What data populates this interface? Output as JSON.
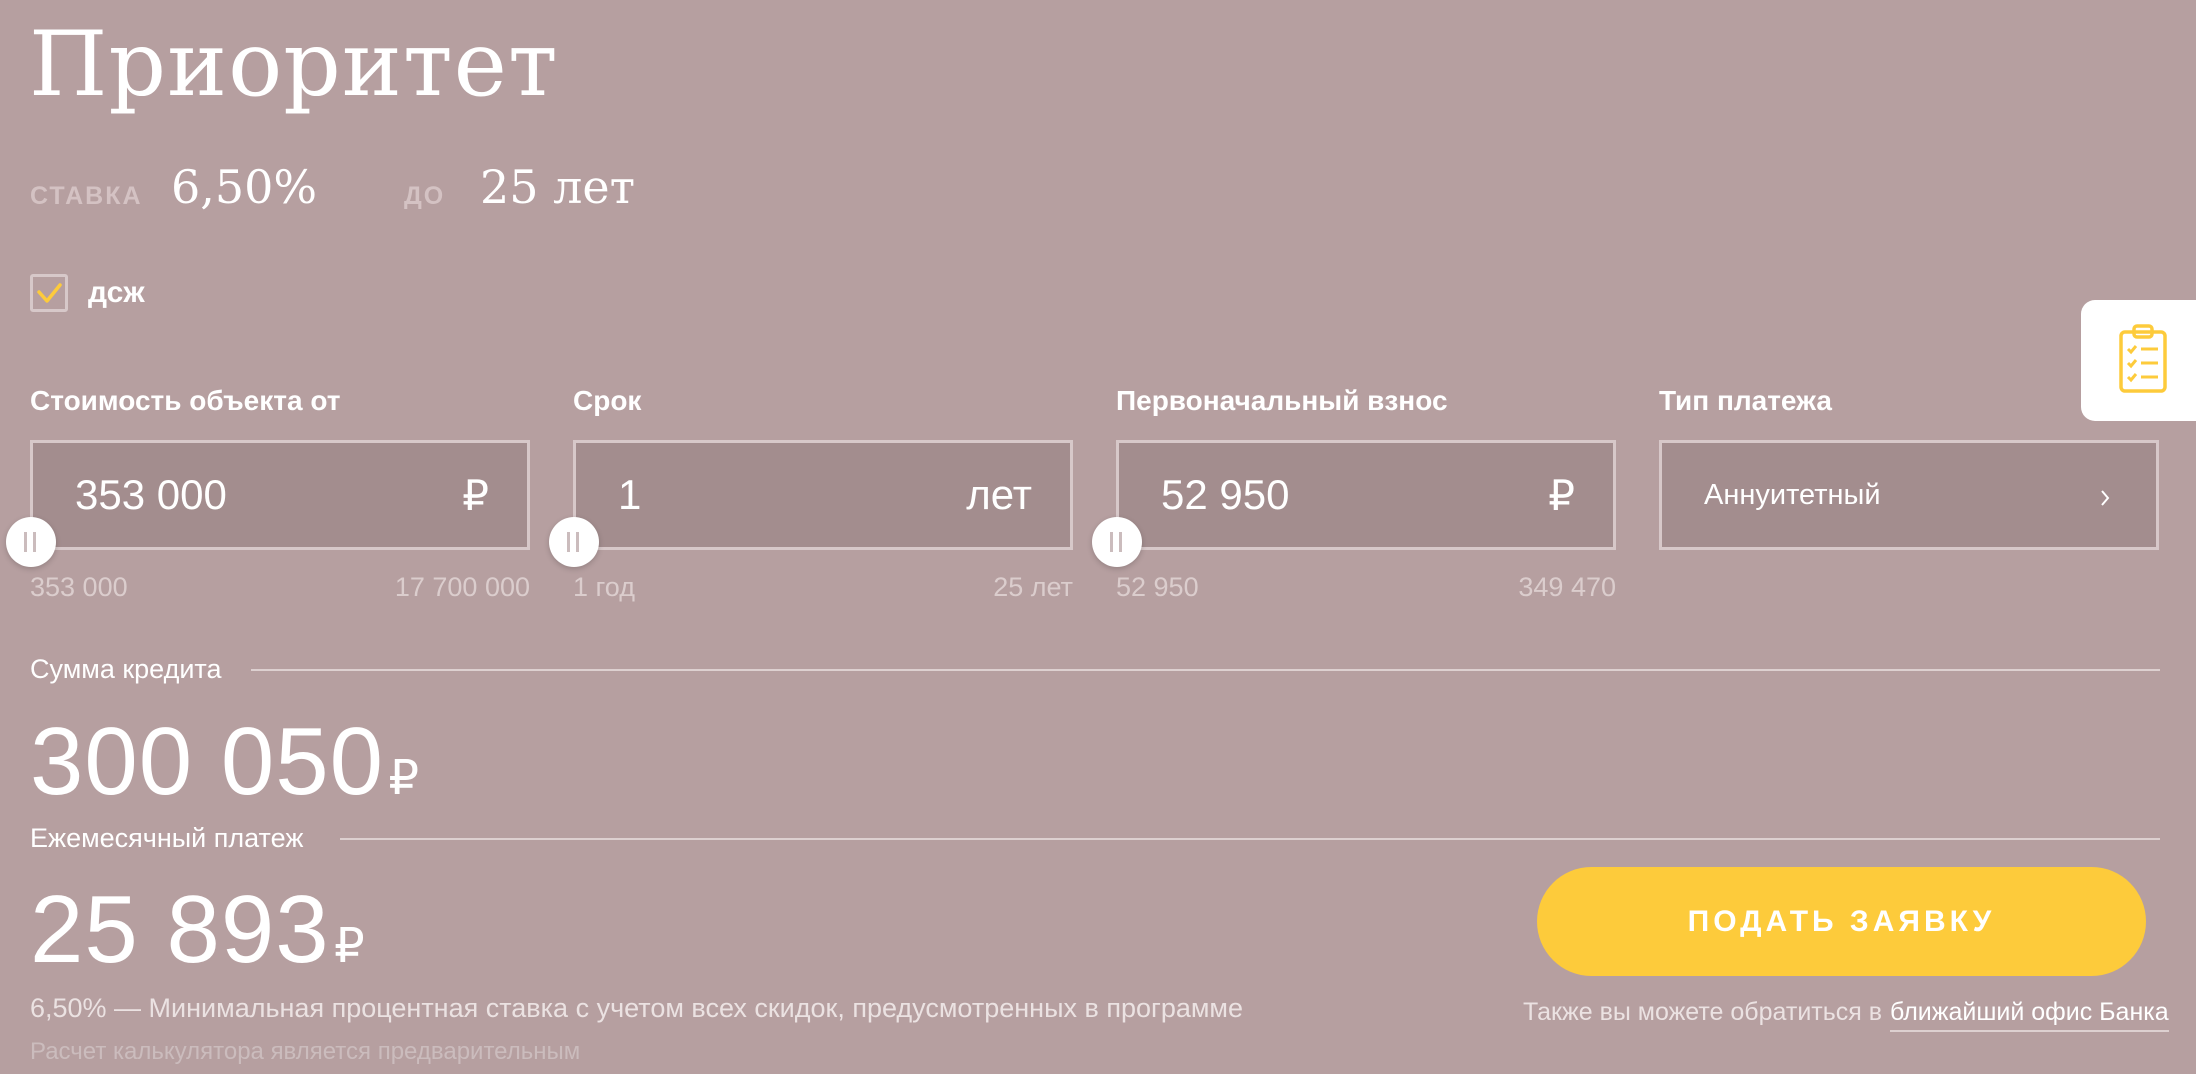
{
  "product": {
    "title": "Приоритет"
  },
  "summary": {
    "rate_label": "ставка",
    "rate_value": "6,50%",
    "term_prefix": "до",
    "term_value": "25 лет"
  },
  "insurance": {
    "label": "дсж",
    "checked": true
  },
  "fields": {
    "price": {
      "label": "Стоимость объекта от",
      "value": "353 000",
      "unit": "₽",
      "min": "353 000",
      "max": "17 700 000"
    },
    "term": {
      "label": "Срок",
      "value": "1",
      "unit": "лет",
      "min": "1 год",
      "max": "25 лет"
    },
    "downpayment": {
      "label": "Первоначальный взнос",
      "value": "52 950",
      "unit": "₽",
      "min": "52 950",
      "max": "349 470"
    },
    "payment_type": {
      "label": "Тип платежа",
      "value": "Аннуитетный"
    }
  },
  "results": {
    "loan_label": "Сумма кредита",
    "loan_value": "300 050",
    "monthly_label": "Ежемесячный платеж",
    "monthly_value": "25 893",
    "currency": "₽"
  },
  "cta": {
    "label": "ПОДАТЬ ЗАЯВКУ"
  },
  "notes": {
    "rate_note": "6,50% — Минимальная процентная ставка с учетом всех скидок, предусмотренных в программе",
    "disclaimer": "Расчет калькулятора является предварительным",
    "office_text": "Также вы можете обратиться в",
    "office_link": "ближайший офис Банка"
  },
  "icons": {
    "side_tab": "clipboard-checklist-icon",
    "select_arrow": "chevron-right-icon",
    "checkbox": "checkmark-icon"
  },
  "colors": {
    "background": "#b69fa0",
    "accent": "#fdcb3b",
    "field_bg": "#a38d8e",
    "border": "#d7c8c9"
  }
}
